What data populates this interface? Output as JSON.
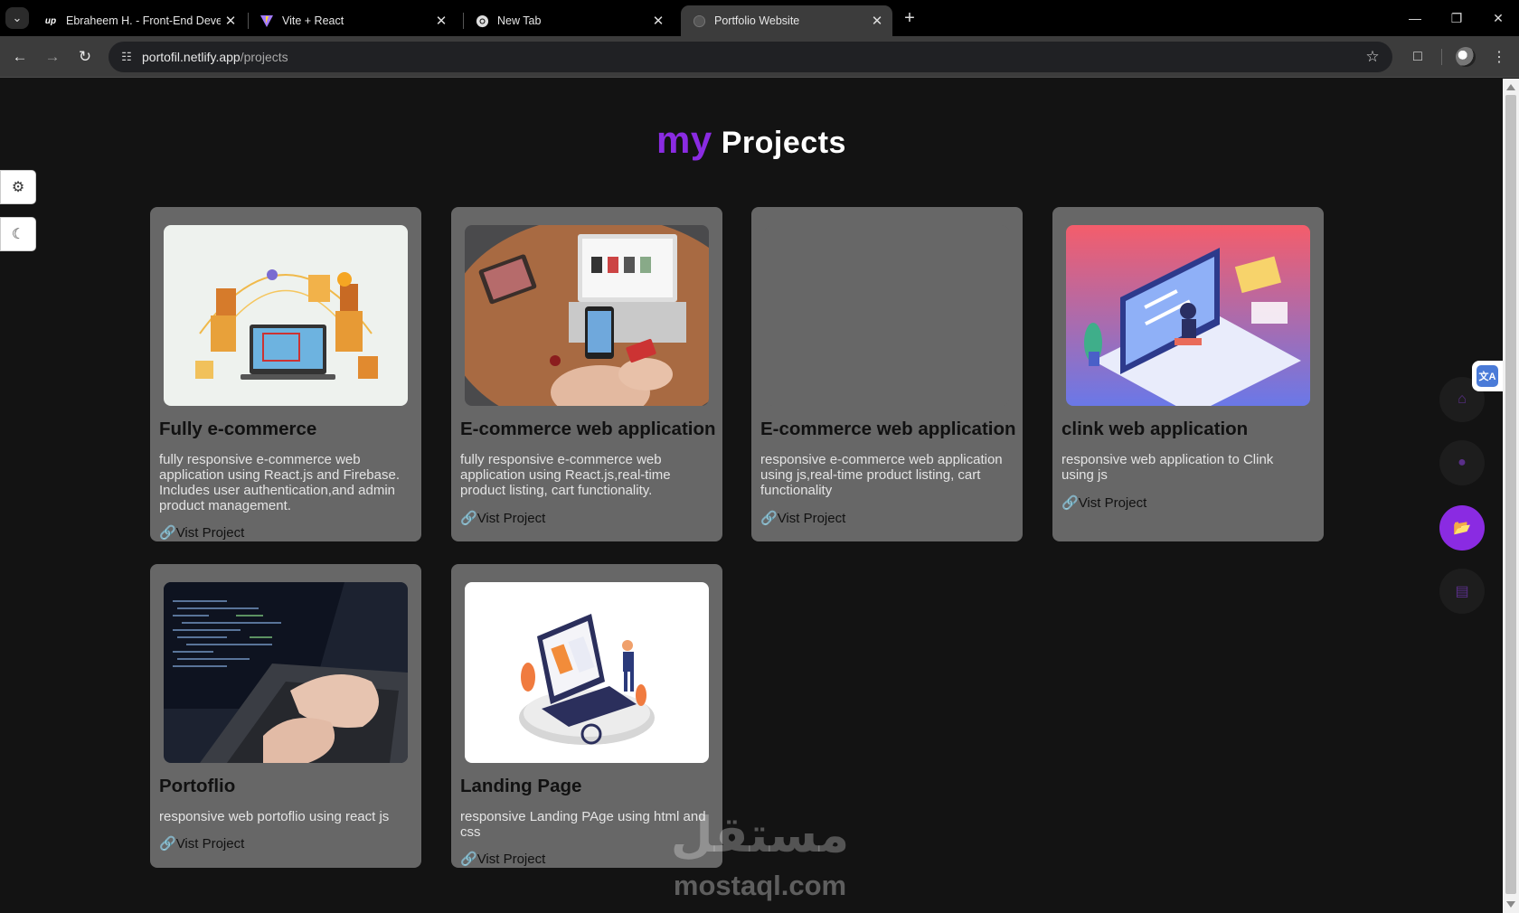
{
  "browser": {
    "tabs": [
      {
        "title": "Ebraheem H. - Front-End Devel",
        "icon": "upwork-icon",
        "favicon_text": "up"
      },
      {
        "title": "Vite + React",
        "icon": "vite-icon"
      },
      {
        "title": "New Tab",
        "icon": "chrome-icon"
      },
      {
        "title": "Portfolio Website",
        "icon": "globe-icon"
      }
    ],
    "url_host": "portofil.netlify.app",
    "url_path": "/projects"
  },
  "page": {
    "title_accent": "my",
    "title": "Projects",
    "accent_color": "#8a2be2"
  },
  "projects": [
    {
      "title": "Fully e-commerce",
      "description": "fully responsive e-commerce web application using React.js and Firebase. Includes user authentication,and admin product management.",
      "link": "Vist Project"
    },
    {
      "title": "E-commerce web application",
      "description": "fully responsive e-commerce web application using React.js,real-time product listing, cart functionality.",
      "link": "Vist Project"
    },
    {
      "title": "E-commerce web application",
      "description": "responsive e-commerce web application using js,real-time product listing, cart functionality",
      "link": "Vist Project"
    },
    {
      "title": "clink web application",
      "description": "responsive web application to Clink using js",
      "link": "Vist Project"
    },
    {
      "title": "Portoflio",
      "description": "responsive web portoflio using react js",
      "link": "Vist Project"
    },
    {
      "title": "Landing Page",
      "description": "responsive Landing PAge using html and css",
      "link": "Vist Project"
    }
  ],
  "side_nav": [
    "home-icon",
    "user-icon",
    "folder-icon",
    "contact-card-icon"
  ],
  "watermark": {
    "arabic": "مستقل",
    "latin": "mostaql.com"
  }
}
